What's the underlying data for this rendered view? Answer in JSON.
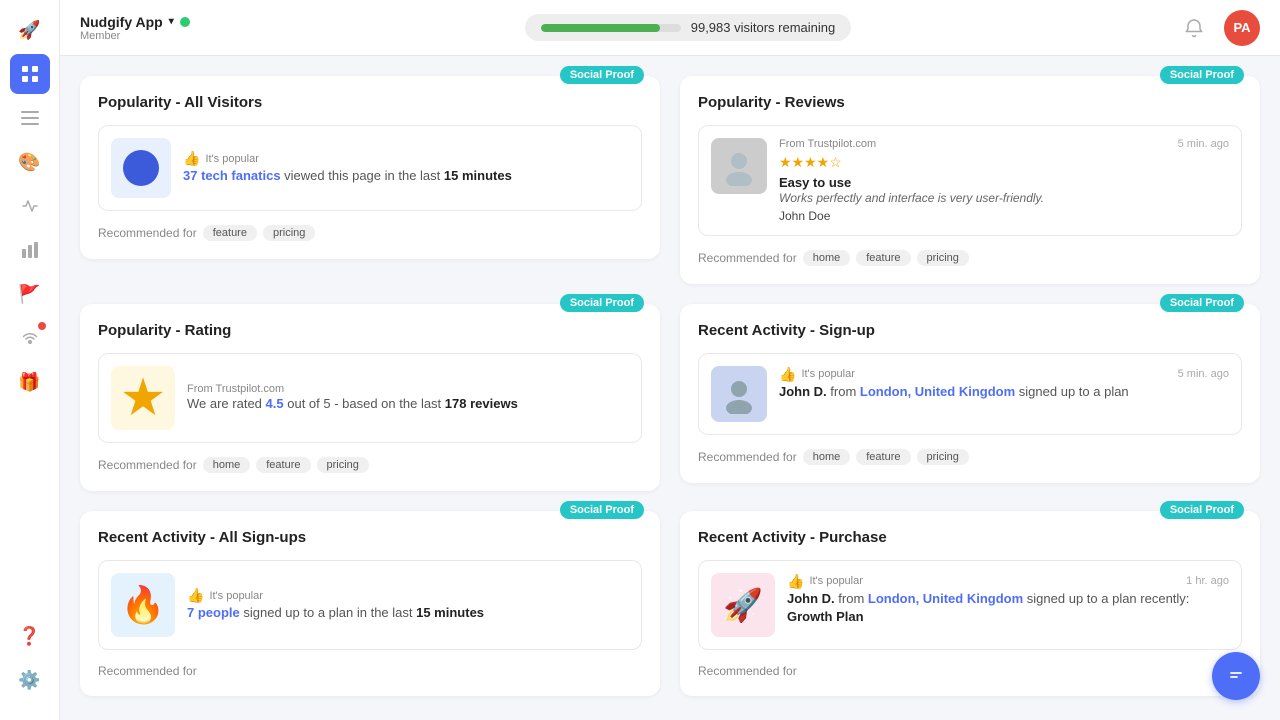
{
  "app": {
    "name": "Nudgify App",
    "status": "online",
    "member_label": "Member",
    "visitor_progress": 85,
    "visitor_text": "99,983 visitors remaining",
    "avatar_initials": "PA"
  },
  "sidebar": {
    "icons": [
      {
        "id": "rocket",
        "symbol": "🚀",
        "active": false
      },
      {
        "id": "dashboard",
        "symbol": "▣",
        "active": true
      },
      {
        "id": "list",
        "symbol": "☰",
        "active": false
      },
      {
        "id": "palette",
        "symbol": "🎨",
        "active": false
      },
      {
        "id": "activity",
        "symbol": "⚡",
        "active": false
      },
      {
        "id": "chart",
        "symbol": "📊",
        "active": false
      },
      {
        "id": "flag",
        "symbol": "🚩",
        "active": false
      },
      {
        "id": "signal",
        "symbol": "📡",
        "active": false,
        "has_badge": true
      },
      {
        "id": "gift",
        "symbol": "🎁",
        "active": false
      }
    ],
    "bottom_icons": [
      {
        "id": "help",
        "symbol": "❓"
      },
      {
        "id": "settings",
        "symbol": "⚙️"
      }
    ]
  },
  "cards": [
    {
      "id": "popularity-all-visitors",
      "badge": "Social Proof",
      "title": "Popularity - All Visitors",
      "notif_header_label": "It's popular",
      "notif_text_plain": " viewed this page in the last ",
      "notif_text_count": "37 tech fanatics",
      "notif_text_suffix": "15 minutes",
      "notif_image_type": "blue_circle",
      "recommended_label": "Recommended for",
      "tags": [
        "feature",
        "pricing"
      ]
    },
    {
      "id": "popularity-reviews",
      "badge": "Social Proof",
      "title": "Popularity - Reviews",
      "time_ago": "5 min. ago",
      "source": "From Trustpilot.com",
      "stars": 4,
      "review_title": "Easy to use",
      "review_body": "Works perfectly and interface is very user-friendly.",
      "review_author": "John Doe",
      "reviewer_image_type": "person",
      "recommended_label": "Recommended for",
      "tags": [
        "home",
        "feature",
        "pricing"
      ]
    },
    {
      "id": "popularity-rating",
      "badge": "Social Proof",
      "title": "Popularity - Rating",
      "source": "From Trustpilot.com",
      "rating_value": "4.5",
      "rating_text_pre": "We are rated ",
      "rating_text_mid": " out of 5 - based on the last ",
      "rating_reviews": "178 reviews",
      "notif_image_type": "star",
      "recommended_label": "Recommended for",
      "tags": [
        "home",
        "feature",
        "pricing"
      ]
    },
    {
      "id": "recent-activity-signup",
      "badge": "Social Proof",
      "title": "Recent Activity - Sign-up",
      "time_ago": "5 min. ago",
      "notif_header_label": "It's popular",
      "person_name": "John D.",
      "person_name_prefix": "",
      "from_label": " from ",
      "location": "London, United Kingdom",
      "action_text": " signed up to a plan",
      "notif_image_type": "person",
      "recommended_label": "Recommended for",
      "tags": [
        "home",
        "feature",
        "pricing"
      ]
    },
    {
      "id": "recent-activity-signups",
      "badge": "Social Proof",
      "title": "Recent Activity - All Sign-ups",
      "notif_header_label": "It's popular",
      "notif_text_count": "7 people",
      "notif_text_plain": " signed up to a plan in the last ",
      "notif_text_suffix": "15 minutes",
      "notif_image_type": "flame",
      "recommended_label": "Recommended for",
      "tags": []
    },
    {
      "id": "recent-activity-purchase",
      "badge": "Social Proof",
      "title": "Recent Activity - Purchase",
      "time_ago": "1 hr. ago",
      "notif_header_label": "It's popular",
      "person_name": "John D.",
      "from_label": " from ",
      "location": "London, United Kingdom",
      "action_text": " signed up to a plan recently: ",
      "plan_name": "Growth Plan",
      "notif_image_type": "rocket_image",
      "recommended_label": "Recommended for",
      "tags": []
    }
  ]
}
